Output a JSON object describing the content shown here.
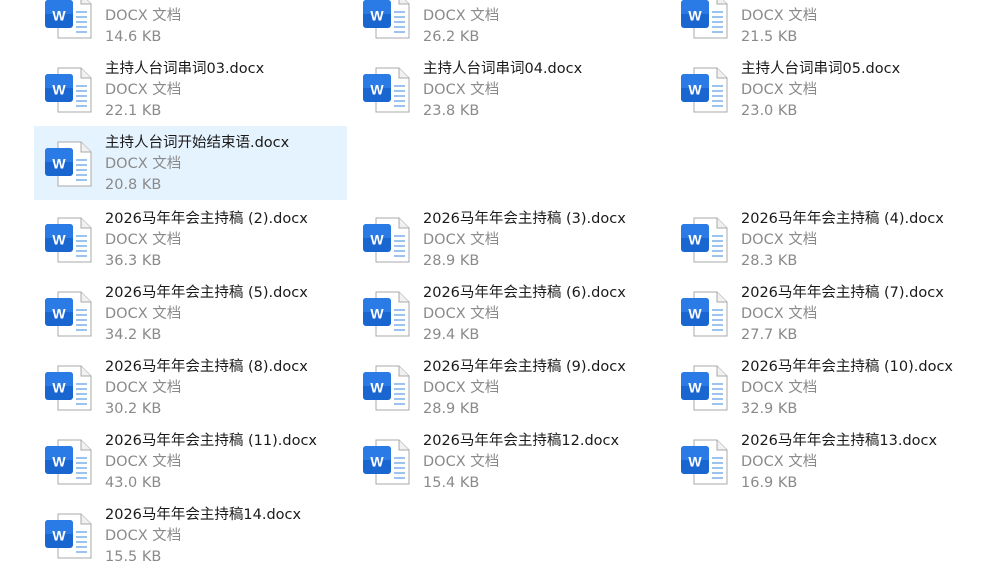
{
  "colors": {
    "selected_bg": "#e5f3ff",
    "word_blue": "#1565c0",
    "page_bg": "#ffffff"
  },
  "icon_name": "word-document-icon",
  "groups": [
    {
      "files": [
        {
          "name": "",
          "type": "DOCX 文档",
          "size": "14.6 KB"
        },
        {
          "name": "",
          "type": "DOCX 文档",
          "size": "26.2 KB"
        },
        {
          "name": "",
          "type": "DOCX 文档",
          "size": "21.5 KB"
        },
        {
          "name": "主持人台词串词03.docx",
          "type": "DOCX 文档",
          "size": "22.1 KB"
        },
        {
          "name": "主持人台词串词04.docx",
          "type": "DOCX 文档",
          "size": "23.8 KB"
        },
        {
          "name": "主持人台词串词05.docx",
          "type": "DOCX 文档",
          "size": "23.0 KB"
        },
        {
          "name": "主持人台词开始结束语.docx",
          "type": "DOCX 文档",
          "size": "20.8 KB",
          "selected": true
        }
      ]
    },
    {
      "files": [
        {
          "name": "2026马年年会主持稿 (2).docx",
          "type": "DOCX 文档",
          "size": "36.3 KB"
        },
        {
          "name": "2026马年年会主持稿 (3).docx",
          "type": "DOCX 文档",
          "size": "28.9 KB"
        },
        {
          "name": "2026马年年会主持稿 (4).docx",
          "type": "DOCX 文档",
          "size": "28.3 KB"
        },
        {
          "name": "2026马年年会主持稿 (5).docx",
          "type": "DOCX 文档",
          "size": "34.2 KB"
        },
        {
          "name": "2026马年年会主持稿 (6).docx",
          "type": "DOCX 文档",
          "size": "29.4 KB"
        },
        {
          "name": "2026马年年会主持稿 (7).docx",
          "type": "DOCX 文档",
          "size": "27.7 KB"
        },
        {
          "name": "2026马年年会主持稿 (8).docx",
          "type": "DOCX 文档",
          "size": "30.2 KB"
        },
        {
          "name": "2026马年年会主持稿 (9).docx",
          "type": "DOCX 文档",
          "size": "28.9 KB"
        },
        {
          "name": "2026马年年会主持稿 (10).docx",
          "type": "DOCX 文档",
          "size": "32.9 KB"
        },
        {
          "name": "2026马年年会主持稿 (11).docx",
          "type": "DOCX 文档",
          "size": "43.0 KB"
        },
        {
          "name": "2026马年年会主持稿12.docx",
          "type": "DOCX 文档",
          "size": "15.4 KB"
        },
        {
          "name": "2026马年年会主持稿13.docx",
          "type": "DOCX 文档",
          "size": "16.9 KB"
        },
        {
          "name": "2026马年年会主持稿14.docx",
          "type": "DOCX 文档",
          "size": "15.5 KB"
        }
      ]
    }
  ]
}
